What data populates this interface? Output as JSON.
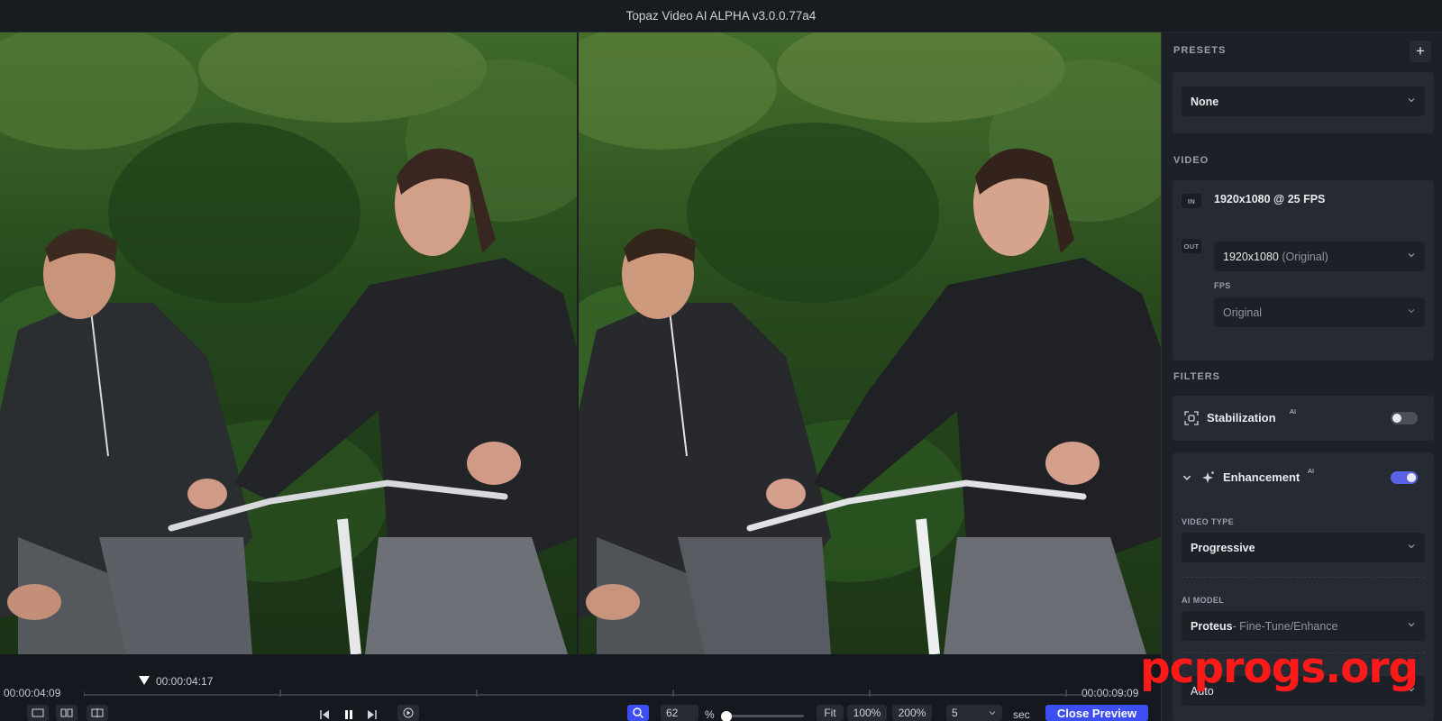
{
  "window": {
    "title": "Topaz Video AI ALPHA  v3.0.0.77a4"
  },
  "colors": {
    "accent": "#3c4ef2",
    "panel": "#1d2027",
    "card": "#262a32",
    "watermark": "#ff1a1a"
  },
  "panel": {
    "presets": {
      "title": "PRESETS",
      "add_label": "+",
      "selected": "None"
    },
    "video": {
      "title": "VIDEO",
      "in_tag": "IN",
      "input_spec": "1920x1080 @ 25 FPS",
      "out_tag": "OUT",
      "output_resolution": "1920x1080",
      "output_resolution_note": "(Original)",
      "fps_label": "FPS",
      "fps_value": "Original"
    },
    "filters": {
      "title": "FILTERS",
      "stabilization": {
        "label": "Stabilization",
        "ai": "AI",
        "enabled": false
      },
      "enhancement": {
        "label": "Enhancement",
        "ai": "AI",
        "enabled": true,
        "video_type_label": "VIDEO TYPE",
        "video_type_value": "Progressive",
        "ai_model_label": "AI MODEL",
        "ai_model_name": "Proteus",
        "ai_model_mode": " - Fine-Tune/Enhance",
        "next_value": "Auto"
      }
    }
  },
  "timeline": {
    "start_time": "00:00:04:09",
    "playhead_time": "00:00:04:17",
    "end_time": "00:00:09:09"
  },
  "toolbar": {
    "zoom_value": "62",
    "zoom_unit": "%",
    "fit_label": "Fit",
    "zoom_100": "100%",
    "zoom_200": "200%",
    "duration_value": "5",
    "duration_unit": "sec",
    "close_preview": "Close Preview"
  },
  "watermark": "pcprogs.org"
}
